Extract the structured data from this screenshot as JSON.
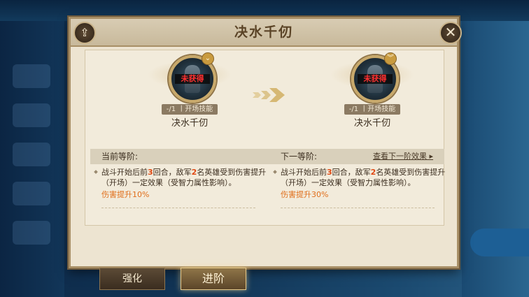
{
  "dialog": {
    "title": "决水千仞",
    "share_icon": "share-icon",
    "close_icon": "close-icon",
    "close_glyph": "✕",
    "share_glyph": "⇪"
  },
  "skills": {
    "current": {
      "status": "未获得",
      "tag": "-/1 丨开场技能",
      "name": "决水千仞"
    },
    "next": {
      "status": "未获得",
      "tag": "-/1 丨开场技能",
      "name": "决水千仞"
    }
  },
  "levels": {
    "current_label": "当前等阶:",
    "next_label": "下一等阶:",
    "view_next_link": "查看下一阶效果 ▸",
    "current_desc": {
      "part1": "战斗开始后前",
      "rounds": "3",
      "part2": "回合，敌军",
      "heroes": "2",
      "part3": "名英雄受到伤害提升（开场）一定效果（受智力属性影响）。",
      "effect": "伤害提升10%"
    },
    "next_desc": {
      "part1": "战斗开始后前",
      "rounds": "3",
      "part2": "回合，敌军",
      "heroes": "2",
      "part3": "名英雄受到伤害提升（开场）一定效果（受智力属性影响）。",
      "effect": "伤害提升30%"
    }
  },
  "tabs": {
    "enhance": "强化",
    "advance": "进阶"
  },
  "colors": {
    "highlight": "#e04a14",
    "effect": "#e06f1c",
    "panel": "#ede4d1",
    "frame": "#a88f66"
  }
}
